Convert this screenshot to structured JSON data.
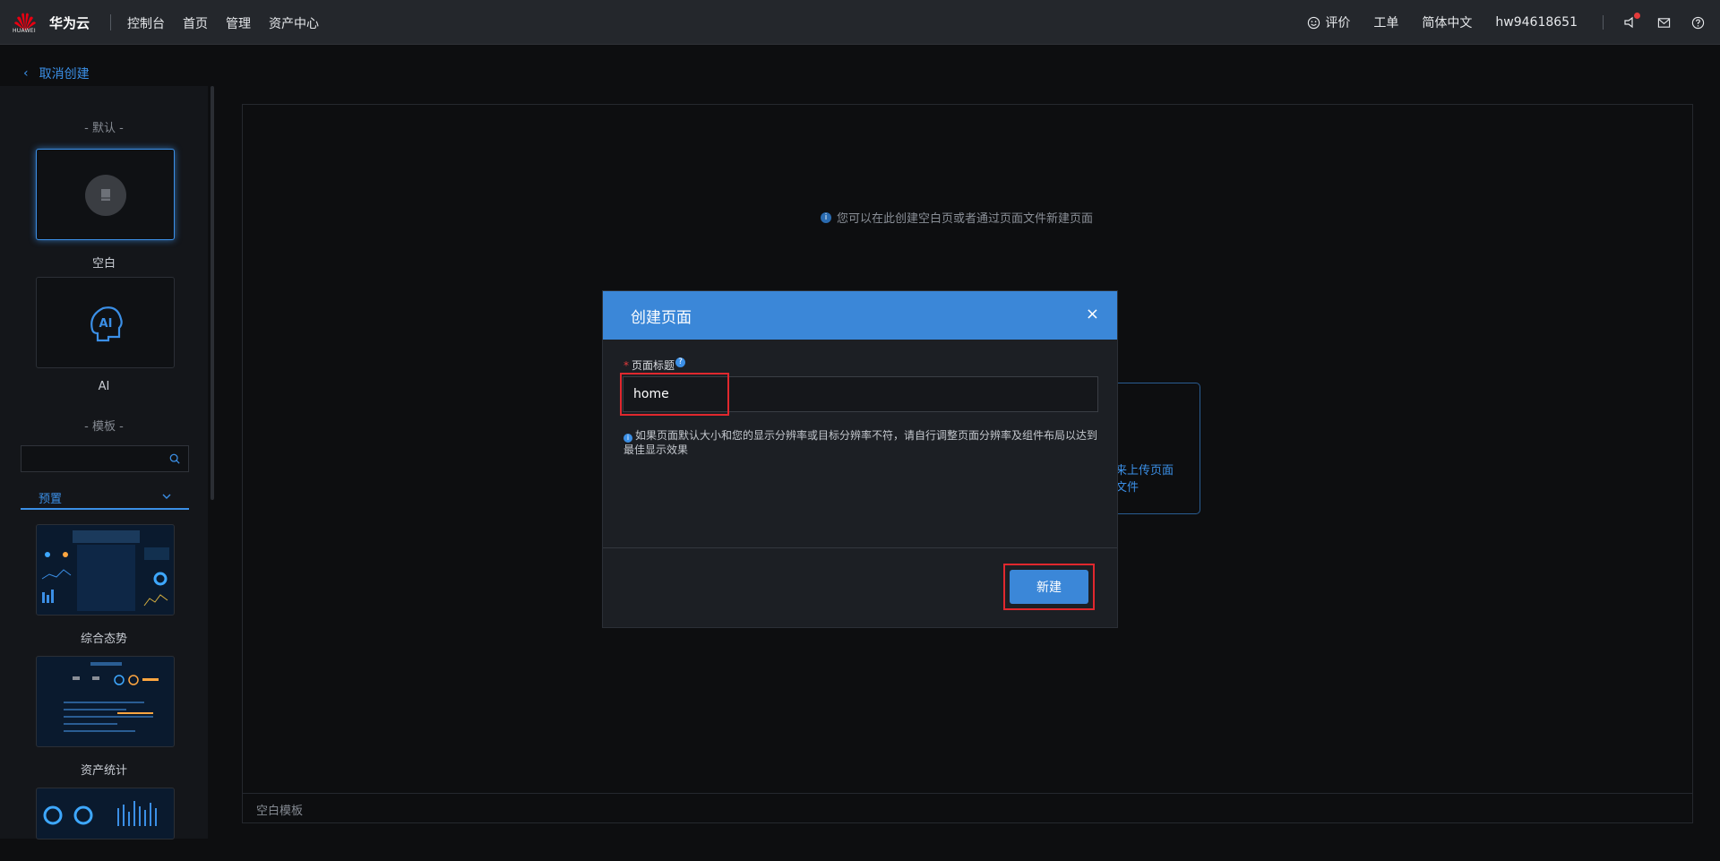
{
  "topbar": {
    "logo_text": "HUAWEI",
    "brand": "华为云",
    "nav": [
      "控制台",
      "首页",
      "管理",
      "资产中心"
    ],
    "right": {
      "feedback": "评价",
      "ticket": "工单",
      "language": "简体中文",
      "username": "hw94618651"
    }
  },
  "cancel_label": "取消创建",
  "sidebar": {
    "default_section": "- 默认 -",
    "templates_section": "- 模板 -",
    "blank_label": "空白",
    "ai_label": "AI",
    "ai_icon_text": "AI",
    "search_placeholder": "",
    "tab_label": "预置",
    "templates": [
      "综合态势",
      "资产统计"
    ]
  },
  "main": {
    "hint": "您可以在此创建空白页或者通过页面文件新建页面",
    "upload_text_line1": "来上传页面",
    "upload_text_line2": "文件",
    "footer": "空白模板"
  },
  "modal": {
    "title": "创建页面",
    "close": "×",
    "field_label": "页面标题",
    "field_value": "home",
    "note": "如果页面默认大小和您的显示分辨率或目标分辨率不符，请自行调整页面分辨率及组件布局以达到最佳显示效果",
    "submit": "新建"
  },
  "colors": {
    "accent": "#3b87d8",
    "highlight": "#e0282e",
    "background": "#0d0e10"
  }
}
